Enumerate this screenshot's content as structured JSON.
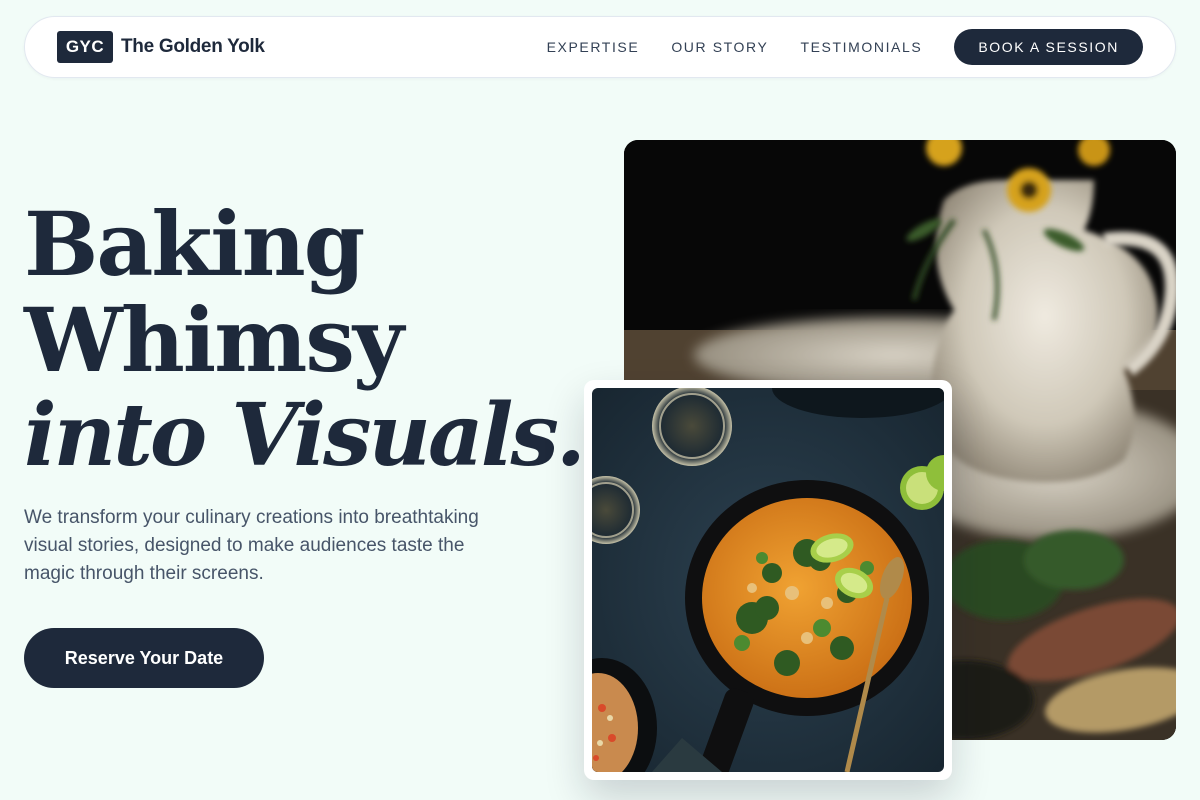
{
  "brand": {
    "logo_text": "GYC",
    "name": "The Golden Yolk"
  },
  "nav": {
    "links": [
      "EXPERTISE",
      "OUR STORY",
      "TESTIMONIALS"
    ],
    "cta_label": "BOOK A SESSION"
  },
  "hero": {
    "headline_line1": "Baking",
    "headline_line2": "Whimsy",
    "headline_line3": "into Visuals.",
    "description": "We transform your culinary creations into breathtaking visual stories, designed to make audiences taste the magic through their screens.",
    "cta_label": "Reserve Your Date"
  },
  "images": {
    "back": "still life with white pitcher, yellow flowers and roasted vegetables",
    "front": "cast iron skillet with orange curry, broccoli, lime and spoon on dark slate"
  },
  "colors": {
    "background": "#f2fcf8",
    "primary": "#1e293b",
    "text_muted": "#475569",
    "nav_bg": "#ffffff"
  }
}
